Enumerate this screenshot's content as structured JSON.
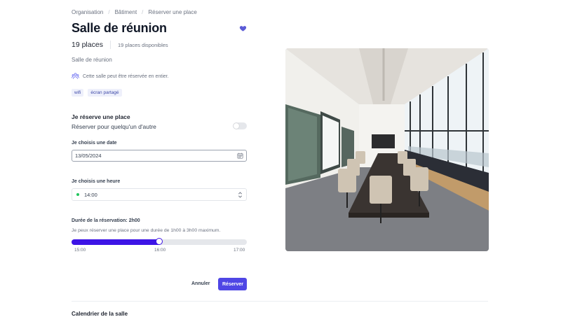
{
  "breadcrumb": [
    "Organisation",
    "Bâtiment",
    "Réserver une place"
  ],
  "room": {
    "title": "Salle de réunion",
    "places": "19 places",
    "available": "19 places disponibles",
    "type": "Salle de réunion",
    "full_booking_notice": "Cette salle peut être réservée en entier.",
    "tags": [
      "wifi",
      "écran partagé"
    ]
  },
  "booking": {
    "section_title": "Je réserve une place",
    "for_other_label": "Réserver pour quelqu'un d'autre",
    "for_other_enabled": false,
    "date_label": "Je choisis une date",
    "date_value": "13/05/2024",
    "hour_label": "Je choisis une heure",
    "hour_value": "14:00",
    "duration_label": "Durée de la réservation: 2h00",
    "duration_help": "Je peux réserver une place pour une durée de 1h00 à 3h00 maximum.",
    "slider": {
      "fill_fraction": 0.5,
      "ticks": [
        "15:00",
        "16:00",
        "17:00"
      ]
    }
  },
  "actions": {
    "cancel": "Annuler",
    "submit": "Réserver"
  },
  "calendar_title": "Calendrier de la salle",
  "colors": {
    "accent": "#4f46e5",
    "slider": "#3d14e6",
    "available_dot": "#22c55e"
  },
  "icons": {
    "favorite": "heart-icon",
    "full_room": "group-icon",
    "date": "calendar-icon",
    "hour": "chevron-updown-icon"
  }
}
